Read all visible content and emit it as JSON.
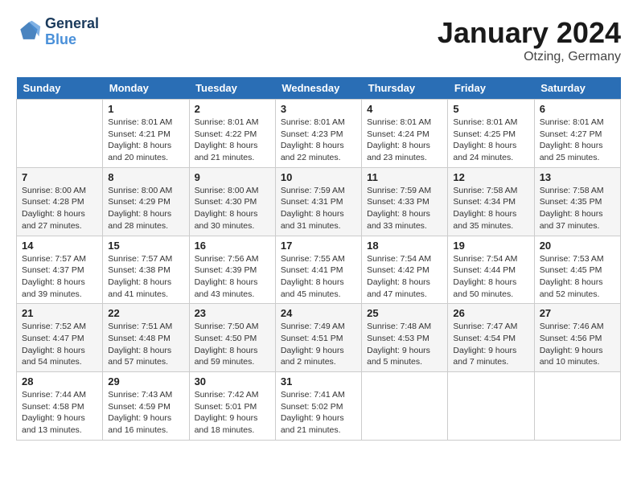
{
  "header": {
    "logo_line1": "General",
    "logo_line2": "Blue",
    "month": "January 2024",
    "location": "Otzing, Germany"
  },
  "weekdays": [
    "Sunday",
    "Monday",
    "Tuesday",
    "Wednesday",
    "Thursday",
    "Friday",
    "Saturday"
  ],
  "weeks": [
    [
      {
        "day": "",
        "info": ""
      },
      {
        "day": "1",
        "info": "Sunrise: 8:01 AM\nSunset: 4:21 PM\nDaylight: 8 hours\nand 20 minutes."
      },
      {
        "day": "2",
        "info": "Sunrise: 8:01 AM\nSunset: 4:22 PM\nDaylight: 8 hours\nand 21 minutes."
      },
      {
        "day": "3",
        "info": "Sunrise: 8:01 AM\nSunset: 4:23 PM\nDaylight: 8 hours\nand 22 minutes."
      },
      {
        "day": "4",
        "info": "Sunrise: 8:01 AM\nSunset: 4:24 PM\nDaylight: 8 hours\nand 23 minutes."
      },
      {
        "day": "5",
        "info": "Sunrise: 8:01 AM\nSunset: 4:25 PM\nDaylight: 8 hours\nand 24 minutes."
      },
      {
        "day": "6",
        "info": "Sunrise: 8:01 AM\nSunset: 4:27 PM\nDaylight: 8 hours\nand 25 minutes."
      }
    ],
    [
      {
        "day": "7",
        "info": "Sunrise: 8:00 AM\nSunset: 4:28 PM\nDaylight: 8 hours\nand 27 minutes."
      },
      {
        "day": "8",
        "info": "Sunrise: 8:00 AM\nSunset: 4:29 PM\nDaylight: 8 hours\nand 28 minutes."
      },
      {
        "day": "9",
        "info": "Sunrise: 8:00 AM\nSunset: 4:30 PM\nDaylight: 8 hours\nand 30 minutes."
      },
      {
        "day": "10",
        "info": "Sunrise: 7:59 AM\nSunset: 4:31 PM\nDaylight: 8 hours\nand 31 minutes."
      },
      {
        "day": "11",
        "info": "Sunrise: 7:59 AM\nSunset: 4:33 PM\nDaylight: 8 hours\nand 33 minutes."
      },
      {
        "day": "12",
        "info": "Sunrise: 7:58 AM\nSunset: 4:34 PM\nDaylight: 8 hours\nand 35 minutes."
      },
      {
        "day": "13",
        "info": "Sunrise: 7:58 AM\nSunset: 4:35 PM\nDaylight: 8 hours\nand 37 minutes."
      }
    ],
    [
      {
        "day": "14",
        "info": "Sunrise: 7:57 AM\nSunset: 4:37 PM\nDaylight: 8 hours\nand 39 minutes."
      },
      {
        "day": "15",
        "info": "Sunrise: 7:57 AM\nSunset: 4:38 PM\nDaylight: 8 hours\nand 41 minutes."
      },
      {
        "day": "16",
        "info": "Sunrise: 7:56 AM\nSunset: 4:39 PM\nDaylight: 8 hours\nand 43 minutes."
      },
      {
        "day": "17",
        "info": "Sunrise: 7:55 AM\nSunset: 4:41 PM\nDaylight: 8 hours\nand 45 minutes."
      },
      {
        "day": "18",
        "info": "Sunrise: 7:54 AM\nSunset: 4:42 PM\nDaylight: 8 hours\nand 47 minutes."
      },
      {
        "day": "19",
        "info": "Sunrise: 7:54 AM\nSunset: 4:44 PM\nDaylight: 8 hours\nand 50 minutes."
      },
      {
        "day": "20",
        "info": "Sunrise: 7:53 AM\nSunset: 4:45 PM\nDaylight: 8 hours\nand 52 minutes."
      }
    ],
    [
      {
        "day": "21",
        "info": "Sunrise: 7:52 AM\nSunset: 4:47 PM\nDaylight: 8 hours\nand 54 minutes."
      },
      {
        "day": "22",
        "info": "Sunrise: 7:51 AM\nSunset: 4:48 PM\nDaylight: 8 hours\nand 57 minutes."
      },
      {
        "day": "23",
        "info": "Sunrise: 7:50 AM\nSunset: 4:50 PM\nDaylight: 8 hours\nand 59 minutes."
      },
      {
        "day": "24",
        "info": "Sunrise: 7:49 AM\nSunset: 4:51 PM\nDaylight: 9 hours\nand 2 minutes."
      },
      {
        "day": "25",
        "info": "Sunrise: 7:48 AM\nSunset: 4:53 PM\nDaylight: 9 hours\nand 5 minutes."
      },
      {
        "day": "26",
        "info": "Sunrise: 7:47 AM\nSunset: 4:54 PM\nDaylight: 9 hours\nand 7 minutes."
      },
      {
        "day": "27",
        "info": "Sunrise: 7:46 AM\nSunset: 4:56 PM\nDaylight: 9 hours\nand 10 minutes."
      }
    ],
    [
      {
        "day": "28",
        "info": "Sunrise: 7:44 AM\nSunset: 4:58 PM\nDaylight: 9 hours\nand 13 minutes."
      },
      {
        "day": "29",
        "info": "Sunrise: 7:43 AM\nSunset: 4:59 PM\nDaylight: 9 hours\nand 16 minutes."
      },
      {
        "day": "30",
        "info": "Sunrise: 7:42 AM\nSunset: 5:01 PM\nDaylight: 9 hours\nand 18 minutes."
      },
      {
        "day": "31",
        "info": "Sunrise: 7:41 AM\nSunset: 5:02 PM\nDaylight: 9 hours\nand 21 minutes."
      },
      {
        "day": "",
        "info": ""
      },
      {
        "day": "",
        "info": ""
      },
      {
        "day": "",
        "info": ""
      }
    ]
  ]
}
